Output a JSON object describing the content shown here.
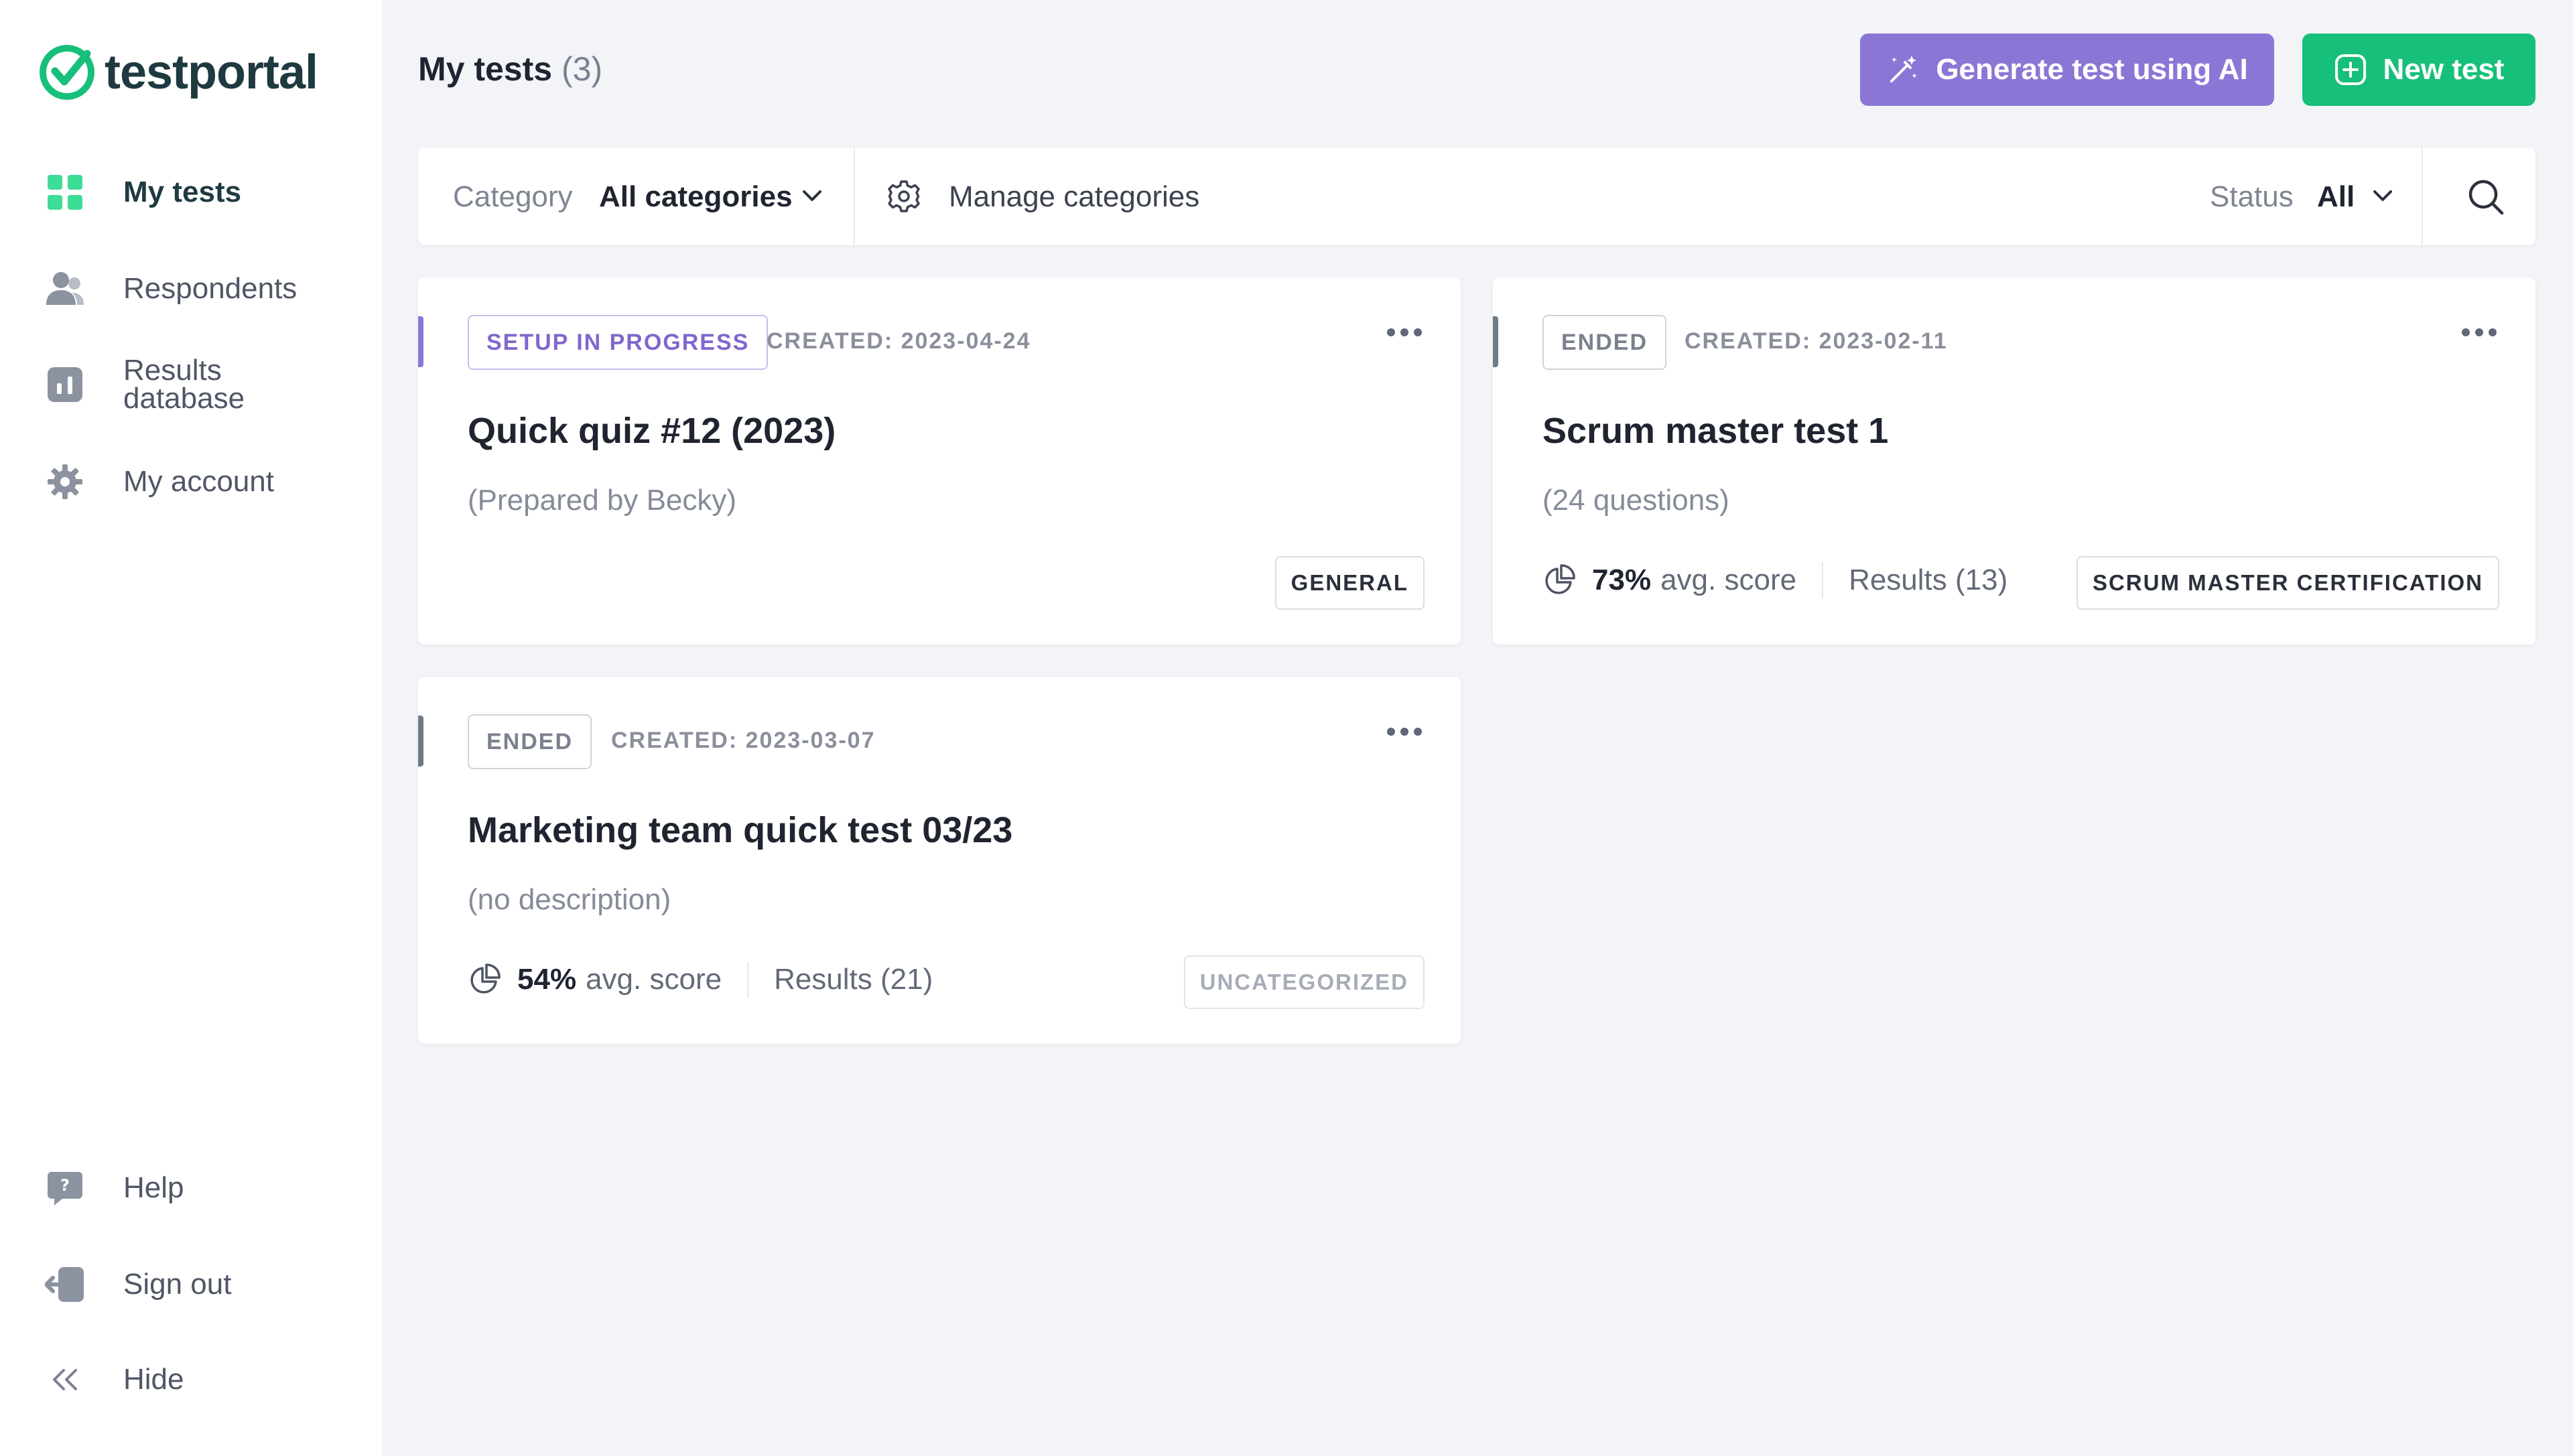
{
  "brand": {
    "name": "testportal",
    "color": "#17c07a"
  },
  "sidebar": {
    "items": [
      {
        "label": "My tests",
        "icon": "grid-icon",
        "active": true
      },
      {
        "label": "Respondents",
        "icon": "users-icon"
      },
      {
        "label": "Results\ndatabase",
        "icon": "chart-icon"
      },
      {
        "label": "My account",
        "icon": "gear-icon"
      }
    ],
    "bottom": [
      {
        "label": "Help",
        "icon": "help-icon"
      },
      {
        "label": "Sign out",
        "icon": "sign-out-icon"
      },
      {
        "label": "Hide",
        "icon": "chevrons-left-icon"
      }
    ]
  },
  "header": {
    "title": "My tests",
    "count": "(3)",
    "ai_button": "Generate test using AI",
    "new_button": "New test"
  },
  "filters": {
    "category_label": "Category",
    "category_value": "All categories",
    "manage_label": "Manage categories",
    "status_label": "Status",
    "status_value": "All"
  },
  "tests": [
    {
      "status": "SETUP IN PROGRESS",
      "created": "CREATED: 2023-04-24",
      "title": "Quick quiz #12 (2023)",
      "description": "(Prepared by Becky)",
      "category": "GENERAL",
      "accent": "#8b76d6"
    },
    {
      "status": "ENDED",
      "created": "CREATED: 2023-02-11",
      "title": "Scrum master test 1",
      "description": "(24 questions)",
      "avg_score": "73%",
      "avg_label": "avg. score",
      "results": "Results (13)",
      "category": "SCRUM MASTER CERTIFICATION",
      "accent": "#6f7a86"
    },
    {
      "status": "ENDED",
      "created": "CREATED: 2023-03-07",
      "title": "Marketing team quick test 03/23",
      "description": "(no description)",
      "avg_score": "54%",
      "avg_label": "avg. score",
      "results": "Results (21)",
      "category": "UNCATEGORIZED",
      "accent": "#6f7a86"
    }
  ]
}
